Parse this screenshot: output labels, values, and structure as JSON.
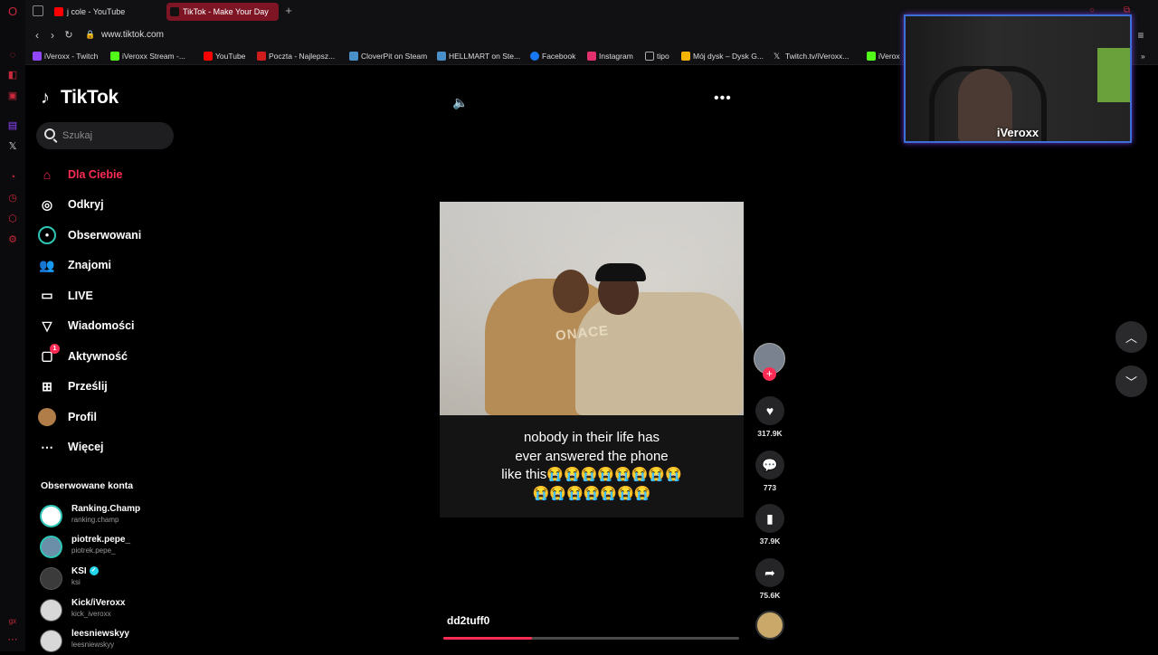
{
  "browser": {
    "tabs": [
      {
        "label": "j cole - YouTube",
        "icon": "youtube-icon",
        "color": "#ff0000"
      },
      {
        "label": "TikTok - Make Your Day",
        "icon": "tiktok-icon",
        "color": "#7d1525"
      }
    ],
    "new_tab": "+",
    "url": "www.tiktok.com",
    "bookmarks": [
      {
        "label": "iVeroxx - Twitch",
        "color": "#9146ff"
      },
      {
        "label": "iVeroxx Stream -...",
        "color": "#53fc18"
      },
      {
        "label": "YouTube",
        "color": "#ff0000"
      },
      {
        "label": "Poczta - Najlepsz...",
        "color": "#d01c1c"
      },
      {
        "label": "CloverPit on Steam",
        "color": "#4a90c8"
      },
      {
        "label": "HELLMART on Ste...",
        "color": "#4a90c8"
      },
      {
        "label": "Facebook",
        "color": "#1877f2"
      },
      {
        "label": "Instagram",
        "color": "#e1306c"
      },
      {
        "label": "tipo",
        "color": "#888888"
      },
      {
        "label": "Mój dysk – Dysk G...",
        "color": "#f4b400"
      },
      {
        "label": "Twitch.tv/iVeroxx...",
        "color": "#dddddd"
      },
      {
        "label": "iVerox",
        "color": "#53fc18"
      }
    ]
  },
  "tiktok": {
    "logo": "TikTok",
    "search_placeholder": "Szukaj",
    "nav": [
      {
        "label": "Dla Ciebie",
        "icon": "home-icon",
        "active": true
      },
      {
        "label": "Odkryj",
        "icon": "compass-icon"
      },
      {
        "label": "Obserwowani",
        "icon": "following-icon"
      },
      {
        "label": "Znajomi",
        "icon": "friends-icon"
      },
      {
        "label": "LIVE",
        "icon": "live-icon"
      },
      {
        "label": "Wiadomości",
        "icon": "messages-icon"
      },
      {
        "label": "Aktywność",
        "icon": "activity-icon",
        "badge": "1"
      },
      {
        "label": "Prześlij",
        "icon": "upload-icon"
      },
      {
        "label": "Profil",
        "icon": "profile-icon"
      },
      {
        "label": "Więcej",
        "icon": "more-icon"
      }
    ],
    "followed_title": "Obserwowane konta",
    "followed": [
      {
        "name": "Ranking.Champ",
        "handle": "ranking.champ"
      },
      {
        "name": "piotrek.pepe_",
        "handle": "piotrek.pepe_"
      },
      {
        "name": "KSI",
        "handle": "ksi",
        "verified": true
      },
      {
        "name": "Kick/iVeroxx",
        "handle": "kick_iveroxx"
      },
      {
        "name": "leesniewskyy",
        "handle": "leesniewskyy"
      }
    ],
    "video": {
      "shirt_text": "ONACE",
      "caption_lines": [
        "nobody in their life has",
        "ever answered the phone",
        "like this😭😭😭😭😭😭😭😭",
        "😭😭😭😭😭😭😭"
      ],
      "author": "dd2tuff0",
      "progress": 0.3,
      "likes": "317.9K",
      "comments": "773",
      "saves": "37.9K",
      "shares": "75.6K"
    }
  },
  "webcam": {
    "name": "iVeroxx"
  },
  "colors": {
    "accent": "#fe2c55",
    "opera": "#c8283c"
  }
}
